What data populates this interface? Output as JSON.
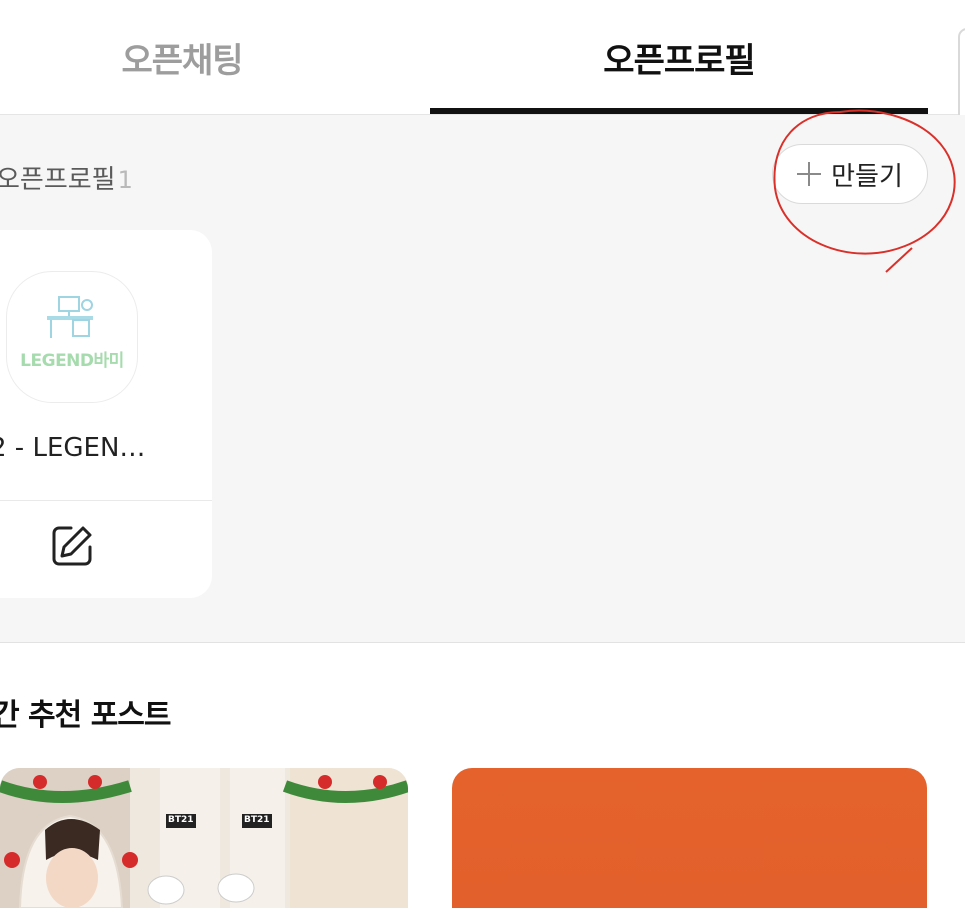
{
  "tabs": [
    {
      "label": "오픈채팅",
      "active": false
    },
    {
      "label": "오픈프로필",
      "active": true
    }
  ],
  "profiles": {
    "count_label": "오픈프로필",
    "count": "1",
    "create_label": "만들기",
    "card": {
      "name": "2 - LEGEN…",
      "logo_text": "LEGEND바미"
    }
  },
  "recommended": {
    "title": "간 추천 포스트",
    "post_1_sign_a": "BT21",
    "post_1_sign_b": "BT21"
  },
  "colors": {
    "active_tab": "#111111",
    "inactive_tab": "#9d9d9d",
    "annotation": "#d9302a",
    "post_orange": "#e5622c"
  },
  "icons": [
    "plus-icon",
    "edit-icon",
    "desk-icon"
  ]
}
